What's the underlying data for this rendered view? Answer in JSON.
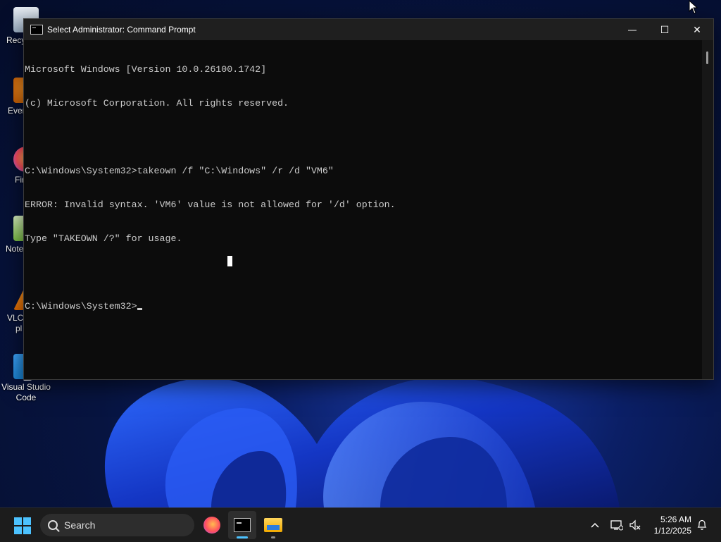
{
  "desktop": {
    "icons": [
      {
        "label": "Recy",
        "icon": "recycle-bin-icon"
      },
      {
        "label": "Ever",
        "icon": "everything-icon"
      },
      {
        "label": "Fir",
        "icon": "firefox-icon"
      },
      {
        "label": "Note",
        "icon": "notepad-plus-plus-icon"
      },
      {
        "label": "VLC",
        "sublabel": "pl",
        "icon": "vlc-icon"
      },
      {
        "label": "Visual Studio",
        "sublabel": "Code",
        "icon": "vscode-icon"
      }
    ]
  },
  "window": {
    "title": "Select Administrator: Command Prompt",
    "controls": {
      "minimize": "—",
      "maximize": "☐",
      "close": "✕"
    },
    "console_lines": [
      "Microsoft Windows [Version 10.0.26100.1742]",
      "(c) Microsoft Corporation. All rights reserved.",
      "",
      "C:\\Windows\\System32>takeown /f \"C:\\Windows\" /r /d \"VM6\"",
      "ERROR: Invalid syntax. 'VM6' value is not allowed for '/d' option.",
      "Type \"TAKEOWN /?\" for usage.",
      ""
    ],
    "prompt": "C:\\Windows\\System32>"
  },
  "taskbar": {
    "search_label": "Search",
    "apps": [
      "firefox-icon",
      "command-prompt-icon",
      "file-explorer-icon"
    ],
    "tray": {
      "chevron": "^"
    },
    "clock": {
      "time": "5:26 AM",
      "date": "1/12/2025"
    }
  },
  "colors": {
    "console_bg": "#0c0c0c",
    "console_fg": "#cccccc",
    "accent": "#4cc2ff",
    "taskbar_bg": "#1c1c1c"
  }
}
